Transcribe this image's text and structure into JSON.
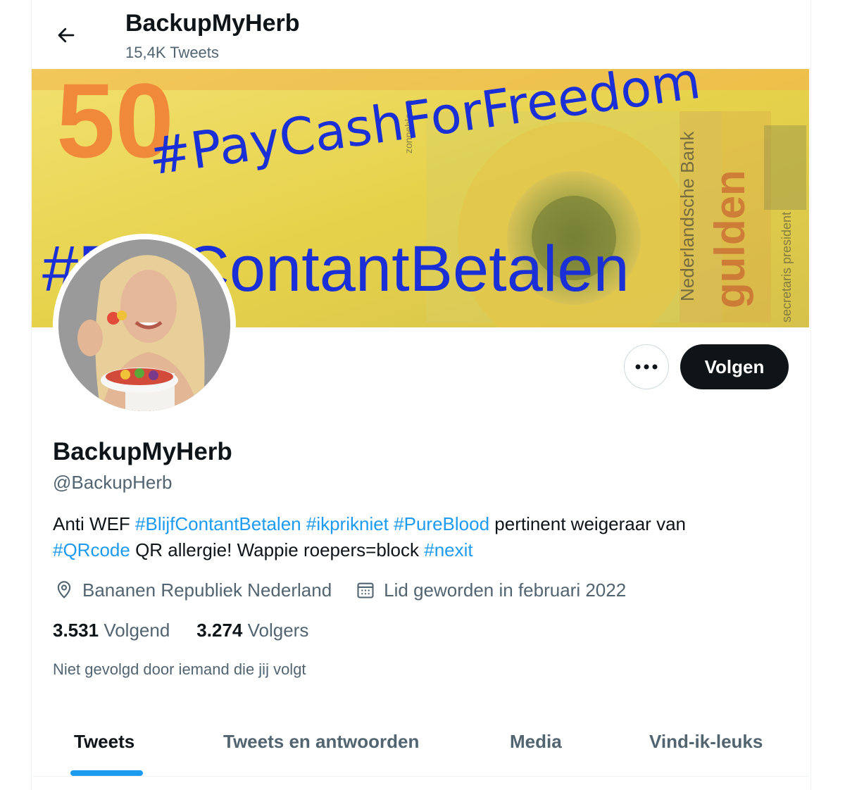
{
  "header": {
    "title": "BackupMyHerb",
    "tweet_count": "15,4K Tweets"
  },
  "banner": {
    "number": "50",
    "hashtag_top": "#PayCashForFreedom",
    "hashtag_bottom": "#BlijfContantBetalen",
    "note_text_1": "gulden",
    "note_text_2": "Nederlandsche Bank",
    "note_text_3": "secretaris president",
    "note_text_4": "zonnebloem"
  },
  "actions": {
    "more_label": "•••",
    "follow_label": "Volgen"
  },
  "profile": {
    "name": "BackupMyHerb",
    "handle": "@BackupHerb",
    "bio": {
      "t1": "Anti WEF ",
      "h1": "#BlijfContantBetalen",
      "s1": " ",
      "h2": "#ikprikniet",
      "s2": " ",
      "h3": "#PureBlood",
      "t2": " pertinent weigeraar van ",
      "h4": "#QRcode",
      "t3": " QR allergie! Wappie roepers=block ",
      "h5": "#nexit"
    },
    "location": "Bananen Republiek Nederland",
    "joined": "Lid geworden in februari 2022",
    "following_count": "3.531",
    "following_label": "Volgend",
    "followers_count": "3.274",
    "followers_label": "Volgers",
    "not_followed": "Niet gevolgd door iemand die jij volgt"
  },
  "tabs": [
    "Tweets",
    "Tweets en antwoorden",
    "Media",
    "Vind-ik-leuks"
  ],
  "colors": {
    "accent": "#1d9bf0",
    "text": "#0f1419",
    "secondary": "#536471",
    "banner_bg": "#e8d65a",
    "banner_orange": "#f08a3a",
    "banner_blue": "#1a2fd6"
  },
  "icons": {
    "back": "arrow-left-icon",
    "more": "more-horizontal-icon",
    "location": "location-pin-icon",
    "calendar": "calendar-icon"
  }
}
